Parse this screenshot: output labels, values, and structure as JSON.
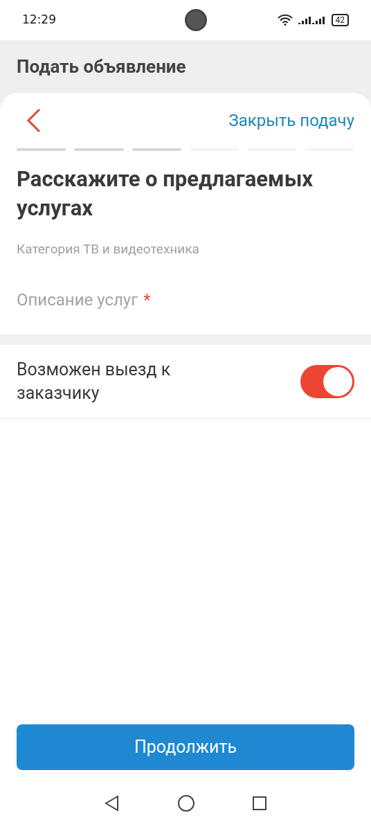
{
  "status_bar": {
    "time": "12:29",
    "battery": "42"
  },
  "header": {
    "title": "Подать объявление"
  },
  "toolbar": {
    "close_label": "Закрыть подачу"
  },
  "steps": [
    {
      "done": true
    },
    {
      "done": true
    },
    {
      "done": true
    },
    {
      "done": false
    },
    {
      "done": false
    },
    {
      "done": false
    }
  ],
  "heading": "Расскажите о предлагаемых услугах",
  "category": "Категория ТВ и видеотехника",
  "description_field": {
    "placeholder": "Описание услуг",
    "required_mark": "*"
  },
  "toggle": {
    "label": "Возможен выезд к заказчику",
    "on": true
  },
  "continue_button": "Продолжить"
}
